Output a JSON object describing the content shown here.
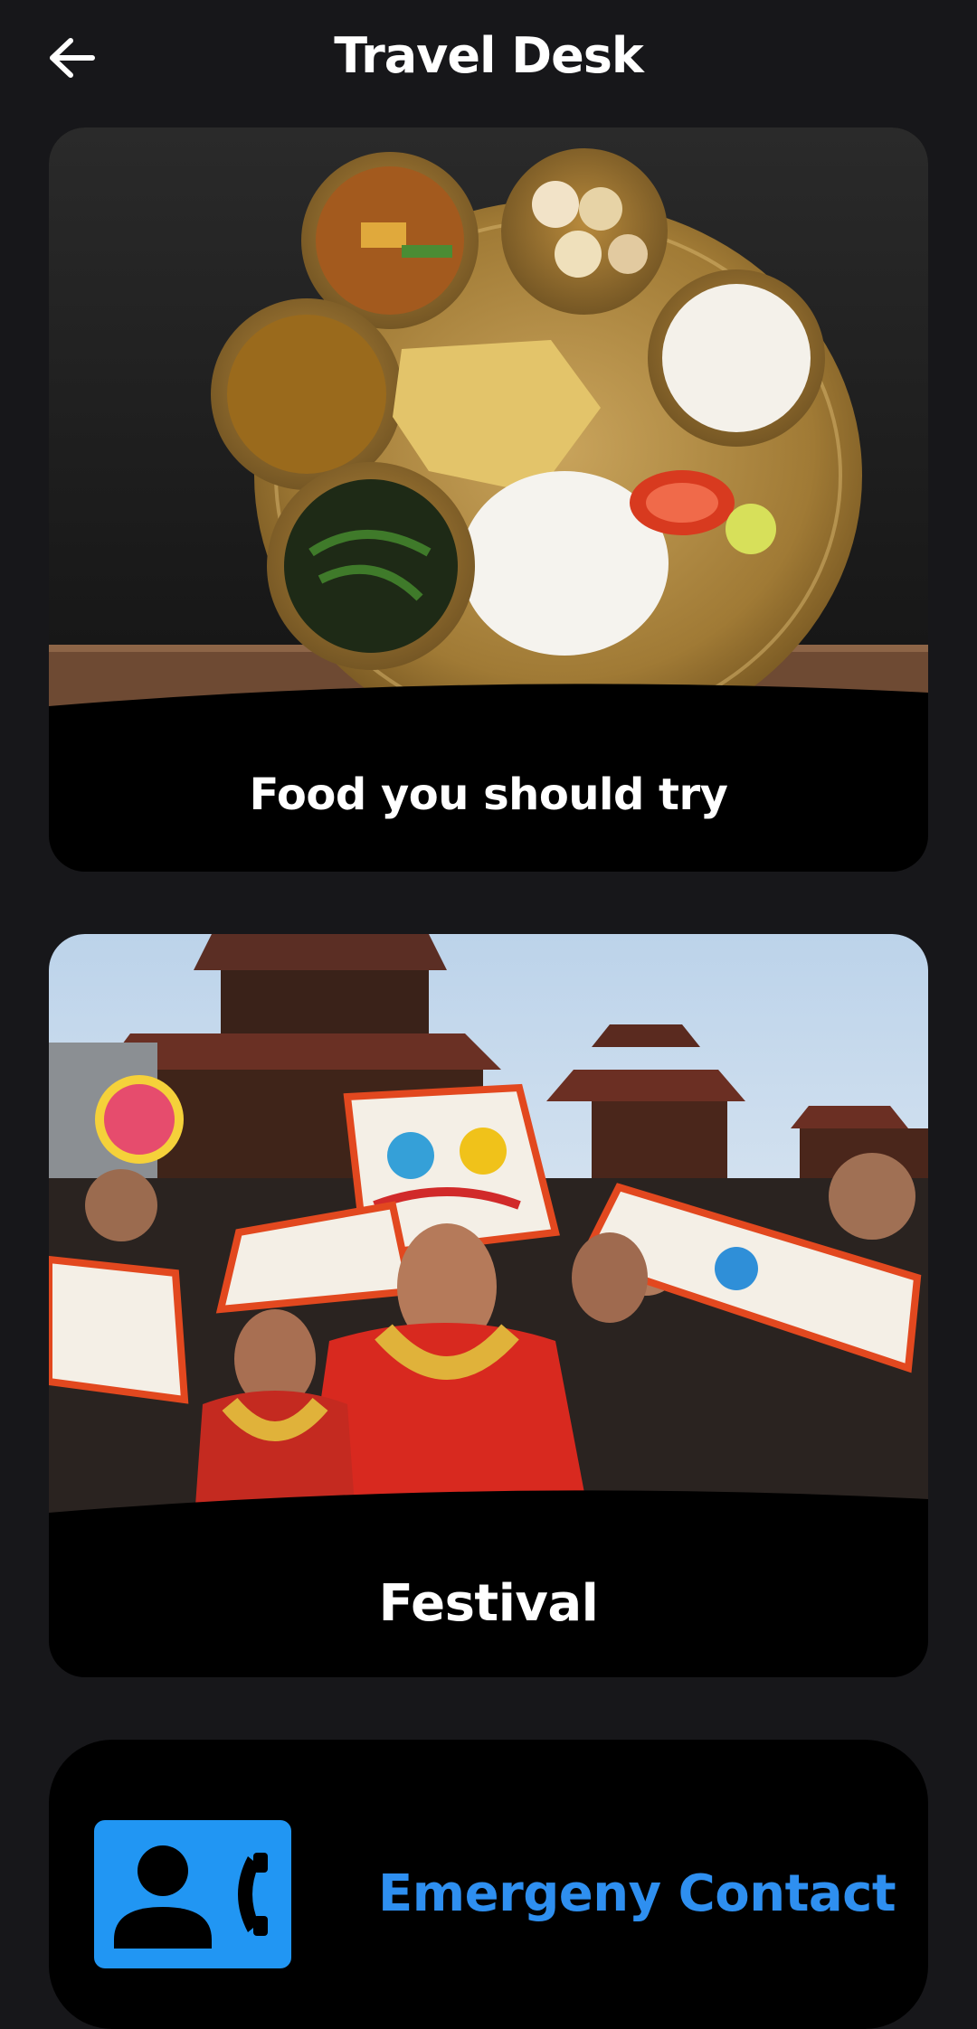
{
  "header": {
    "title": "Travel Desk",
    "back_icon": "arrow-left-icon"
  },
  "cards": [
    {
      "label": "Food you should try",
      "image": "nepali-thali-food-photo"
    },
    {
      "label": "Festival",
      "image": "festival-masked-dancers-photo"
    }
  ],
  "emergency": {
    "label": "Emergeny Contact",
    "icon": "contact-phone-icon"
  },
  "colors": {
    "background": "#17171a",
    "card": "#000000",
    "accent": "#2196f3",
    "accent_text": "#2e8ff0"
  }
}
